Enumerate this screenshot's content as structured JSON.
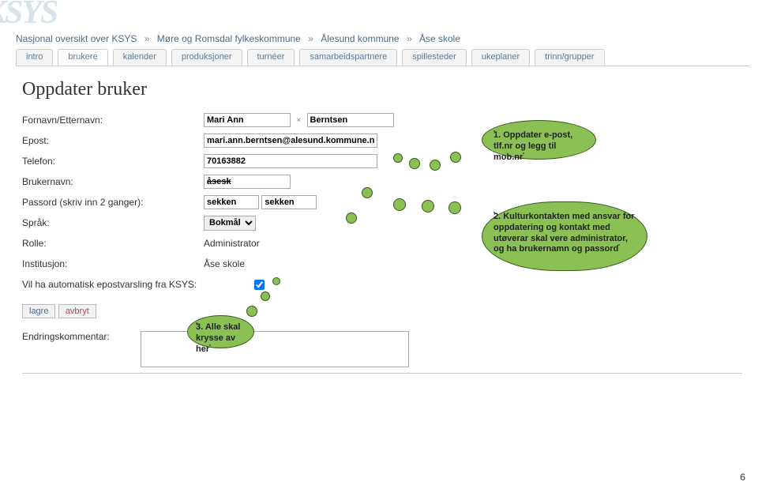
{
  "logo": "KSYS",
  "breadcrumb": [
    "Nasjonal oversikt over KSYS",
    "Møre og Romsdal fylkeskommune",
    "Ålesund kommune",
    "Åse skole"
  ],
  "tabs": [
    {
      "label": "intro",
      "active": false
    },
    {
      "label": "brukere",
      "active": true
    },
    {
      "label": "kalender",
      "active": false
    },
    {
      "label": "produksjoner",
      "active": false
    },
    {
      "label": "turnéer",
      "active": false
    },
    {
      "label": "samarbeidspartnere",
      "active": false
    },
    {
      "label": "spillesteder",
      "active": false
    },
    {
      "label": "ukeplaner",
      "active": false
    },
    {
      "label": "trinn/grupper",
      "active": false
    }
  ],
  "page_title": "Oppdater bruker",
  "form": {
    "firstname_label": "Fornavn/Etternavn:",
    "firstname": "Mari Ann",
    "lastname": "Berntsen",
    "email_label": "Epost:",
    "email": "mari.ann.berntsen@alesund.kommune.no",
    "phone_label": "Telefon:",
    "phone": "70163882",
    "username_label": "Brukernavn:",
    "username": "åsesk",
    "password_label": "Passord (skriv inn 2 ganger):",
    "password1": "sekken",
    "password2": "sekken",
    "language_label": "Språk:",
    "language_value": "Bokmål",
    "role_label": "Rolle:",
    "role_value": "Administrator",
    "institution_label": "Institusjon:",
    "institution_value": "Åse skole",
    "notify_label": "Vil ha automatisk epostvarsling fra KSYS:",
    "notify_checked": true
  },
  "buttons": {
    "save": "lagre",
    "cancel": "avbryt"
  },
  "comment_label": "Endringskommentar:",
  "bubble1": "1. Oppdater e-post, tlf.nr og legg til mob.nr",
  "bubble2": "2. Kulturkontakten med ansvar for oppdatering og kontakt med utøverar skal vere administrator, og ha brukernamn og passord",
  "bubble3": "3. Alle skal krysse av her",
  "page_number": "6"
}
